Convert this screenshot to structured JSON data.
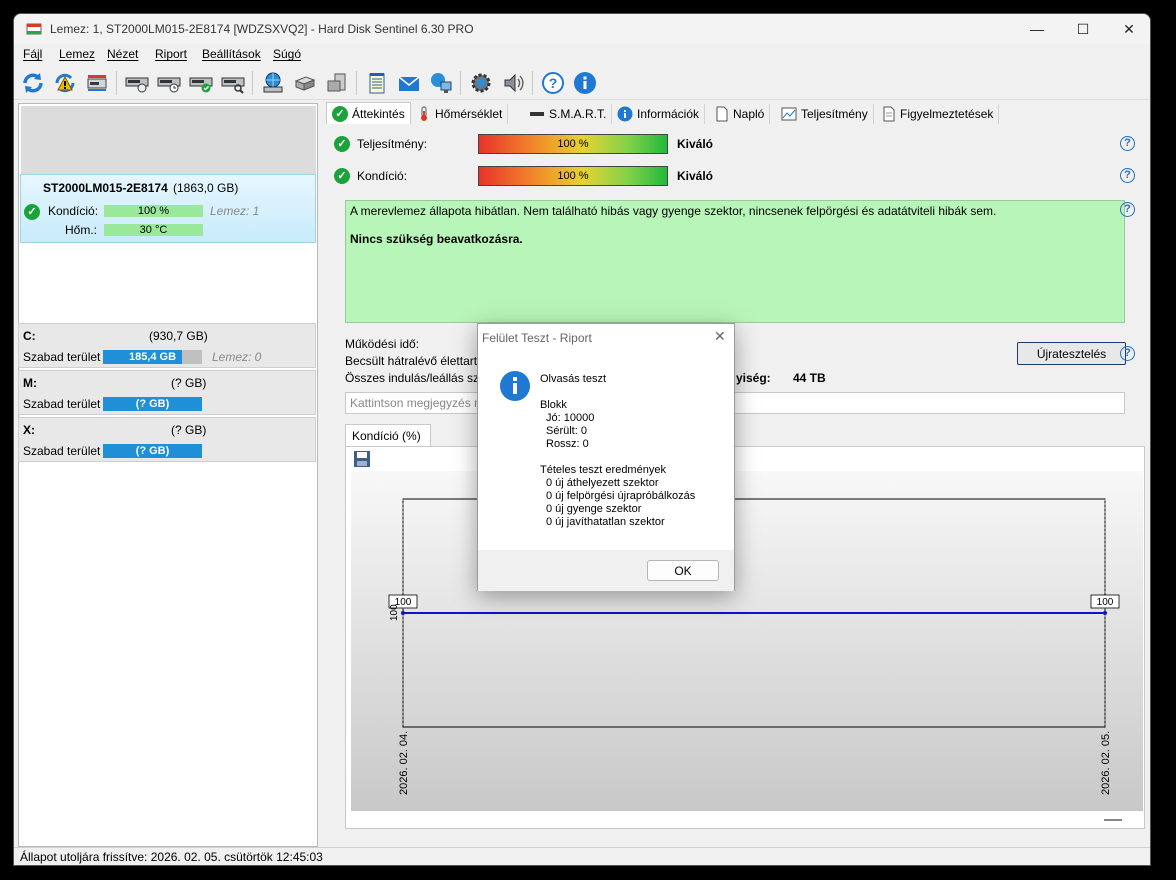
{
  "window": {
    "title": "Lemez: 1, ST2000LM015-2E8174 [WDZSXVQ2]  -  Hard Disk Sentinel 6.30 PRO",
    "minimize": "—",
    "maximize": "☐",
    "close": "✕"
  },
  "menu": [
    "Fájl",
    "Lemez",
    "Nézet",
    "Riport",
    "Beállítások",
    "Súgó"
  ],
  "toolbar": {
    "icons": [
      "refresh-icon",
      "refresh-warning-icon",
      "disk-alert-icon",
      "disk-info-icon",
      "disk-schedule-icon",
      "disk-check-icon",
      "disk-search-icon",
      "network-drive-icon",
      "drive-stack-icon",
      "drive-stack-2-icon",
      "notes-icon",
      "mail-icon",
      "network-icon",
      "settings-gear-icon",
      "speaker-icon",
      "help-icon",
      "info-icon"
    ]
  },
  "disk": {
    "name": "ST2000LM015-2E8174",
    "size": "(1863,0 GB)",
    "condition_label": "Kondíció:",
    "condition_value": "100 %",
    "condition_fraction": 1.0,
    "disk_label": "Lemez: 1",
    "temp_label": "Hőm.:",
    "temp_value": "30 °C"
  },
  "volumes": [
    {
      "letter": "C:",
      "size": "(930,7 GB)",
      "free_label": "Szabad terület",
      "free_value": "185,4 GB",
      "disk": "Lemez: 0",
      "fill": 0.8
    },
    {
      "letter": "M:",
      "size": "(? GB)",
      "free_label": "Szabad terület",
      "free_value": "(? GB)",
      "disk": "",
      "fill": 1.0
    },
    {
      "letter": "X:",
      "size": "(? GB)",
      "free_label": "Szabad terület",
      "free_value": "(? GB)",
      "disk": "",
      "fill": 1.0
    }
  ],
  "tabs": [
    {
      "label": "Áttekintés",
      "icon": "check-icon"
    },
    {
      "label": "Hőmérséklet",
      "icon": "thermometer-icon"
    },
    {
      "label": "S.M.A.R.T.",
      "icon": "smart-icon"
    },
    {
      "label": "Információk",
      "icon": "info-icon"
    },
    {
      "label": "Napló",
      "icon": "document-icon"
    },
    {
      "label": "Teljesítmény",
      "icon": "chart-icon"
    },
    {
      "label": "Figyelmeztetések",
      "icon": "warning-doc-icon"
    }
  ],
  "overview": {
    "performance_label": "Teljesítmény:",
    "performance_value": "100 %",
    "performance_rating": "Kiváló",
    "condition_label": "Kondíció:",
    "condition_value": "100 %",
    "condition_rating": "Kiváló",
    "status_text": "A merevlemez állapota hibátlan. Nem található hibás vagy gyenge szektor, nincsenek felpörgési és adatátviteli hibák sem.",
    "status_action": "Nincs szükség beavatkozásra.",
    "uptime_label": "Működési idő:",
    "remaining_label": "Becsült hátralévő élettartam",
    "startstop_label": "Összes indulás/leállás számá",
    "capacity_label_tail": "yiség:",
    "capacity_value": "44 TB",
    "retest_button": "Újratesztelés",
    "notes_placeholder": "Kattintson megjegyzés meg"
  },
  "chart_tab": "Kondíció  (%)",
  "chart_data": {
    "type": "line",
    "x": [
      "2026. 02. 04.",
      "2026. 02. 05."
    ],
    "values": [
      100,
      100
    ],
    "point_labels": [
      "100",
      "100"
    ],
    "ylabel_tick": "100",
    "line_color": "#0a14c8"
  },
  "statusbar": "Állapot utoljára frissítve: 2026. 02. 05. csütörtök 12:45:03",
  "dialog": {
    "title": "Felület Teszt - Riport",
    "test_name": "Olvasás teszt",
    "block_header": "Blokk",
    "good": "Jó: 10000",
    "damaged": "Sérült: 0",
    "bad": "Rossz: 0",
    "results_header": "Tételes teszt eredmények",
    "r1": "0 új áthelyezett szektor",
    "r2": "0 új felpörgési újrapróbálkozás",
    "r3": "0 új gyenge szektor",
    "r4": "0 új javíthatatlan szektor",
    "ok_button": "OK"
  }
}
